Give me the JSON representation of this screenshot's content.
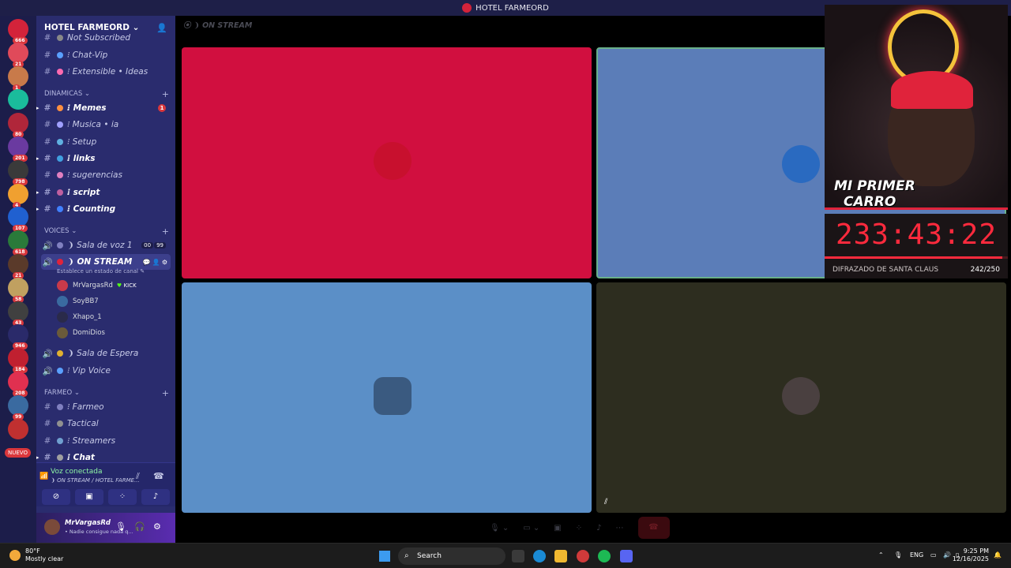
{
  "titlebar": {
    "title": "HOTEL FARMEORD"
  },
  "server": {
    "name": "HOTEL FARMEORD ⌄"
  },
  "rail": {
    "servers": [
      {
        "count": "666",
        "color": "#d3233a"
      },
      {
        "count": "21",
        "color": "#e04a5a"
      },
      {
        "count": "1",
        "color": "#c87a4a"
      },
      {
        "count": "",
        "color": "#1abc9c"
      },
      {
        "count": "80",
        "color": "#b0263a"
      },
      {
        "count": "201",
        "color": "#6a3aa0"
      },
      {
        "count": "798",
        "color": "#3a3a3a"
      },
      {
        "count": "4",
        "color": "#f0a030"
      },
      {
        "count": "107",
        "color": "#2060d0"
      },
      {
        "count": "618",
        "color": "#2a7a3a"
      },
      {
        "count": "21",
        "color": "#5a3a2a"
      },
      {
        "count": "58",
        "color": "#c0a060"
      },
      {
        "count": "43",
        "color": "#404040"
      },
      {
        "count": "946",
        "color": "#2a2a6a"
      },
      {
        "count": "184",
        "color": "#c02030"
      },
      {
        "count": "208",
        "color": "#e03050"
      },
      {
        "count": "99",
        "color": "#3a6aa0"
      },
      {
        "count": "",
        "color": "#c03030"
      }
    ],
    "nuevo": "NUEVO"
  },
  "channels": {
    "top": [
      {
        "label": "Not Subscribed",
        "emoji_color": "#888"
      },
      {
        "label": "⁝ Chat-Vip",
        "emoji_color": "#5aa0ff"
      },
      {
        "label": "⁝ Extensible • Ideas",
        "emoji_color": "#ff6ab0"
      }
    ],
    "cat_dinamicas": "DINAMICAS ⌄",
    "dinamicas": [
      {
        "label": "⁝ Memes",
        "emoji_color": "#ff9040",
        "bold": true,
        "badge": "1"
      },
      {
        "label": "⁝ Musica • ia",
        "emoji_color": "#a0a0ff",
        "bold": false
      },
      {
        "label": "⁝ Setup",
        "emoji_color": "#60b0e0",
        "bold": false
      },
      {
        "label": "⁝ links",
        "emoji_color": "#40a0e0",
        "bold": true
      },
      {
        "label": "⁝ sugerencias",
        "emoji_color": "#e080c0",
        "bold": false
      },
      {
        "label": "⁝ script",
        "emoji_color": "#c060a0",
        "bold": true
      },
      {
        "label": "⁝ Counting",
        "emoji_color": "#4080ff",
        "bold": true
      }
    ],
    "cat_voices": "VOICES ⌄",
    "voice_sala": "❩ Sala de voz 1",
    "voice_sala_count": [
      "00",
      "99"
    ],
    "voice_onstream": "❩ ON STREAM",
    "voice_onstream_status": "Establece un estado de canal ✎",
    "voice_users": [
      {
        "name": "MrVargasRd",
        "color": "#c83a4a",
        "kick": true
      },
      {
        "name": "SoyBB7",
        "color": "#3a6aa0",
        "kick": false
      },
      {
        "name": "Xhapo_1",
        "color": "#2a2a4a",
        "kick": false
      },
      {
        "name": "DomiDios",
        "color": "#6a5a3a",
        "kick": false
      }
    ],
    "kick_label": "KICK",
    "voice_espera": "❩ Sala de Espera",
    "voice_vip": "⁝ Vip Voice",
    "cat_farmeo": "FARMEO ⌄",
    "farmeo": [
      {
        "label": "⁝ Farmeo",
        "emoji_color": "#8080c0",
        "bold": false
      },
      {
        "label": "Tactical",
        "emoji_color": "#909090",
        "bold": false
      },
      {
        "label": "⁝ Streamers",
        "emoji_color": "#70a0d0",
        "bold": false
      },
      {
        "label": "⁝ Chat",
        "emoji_color": "#a0a0a0",
        "bold": true
      }
    ]
  },
  "voice_panel": {
    "title": "Voz conectada",
    "sub": "❩ ON STREAM / HOTEL FARME..."
  },
  "user_panel": {
    "name": "MrVargasRd",
    "status": "• Nadie consigue nada q..."
  },
  "main": {
    "header": "❩ ON STREAM"
  },
  "tiles": [
    {
      "color": "#d10f3f",
      "avatar_color": "#c8102e"
    },
    {
      "color": "#5b7db8",
      "avatar_color": "#2a6ac0"
    },
    {
      "color": "#5b8fc7",
      "avatar_color": "#3a5a80"
    },
    {
      "color": "#2d2d1f",
      "avatar_color": "#4a4040"
    }
  ],
  "overlay": {
    "banner_line1": "MI PRIMER",
    "banner_line2": "CARRO",
    "timer": "233:43:22",
    "goal_label": "DIFRAZADO DE SANTA CLAUS",
    "goal_count": "242/250",
    "goal_progress": 0.968
  },
  "taskbar": {
    "temp": "80°F",
    "weather": "Mostly clear",
    "search": "Search",
    "lang": "ENG",
    "time": "9:25 PM",
    "date": "12/16/2025"
  }
}
